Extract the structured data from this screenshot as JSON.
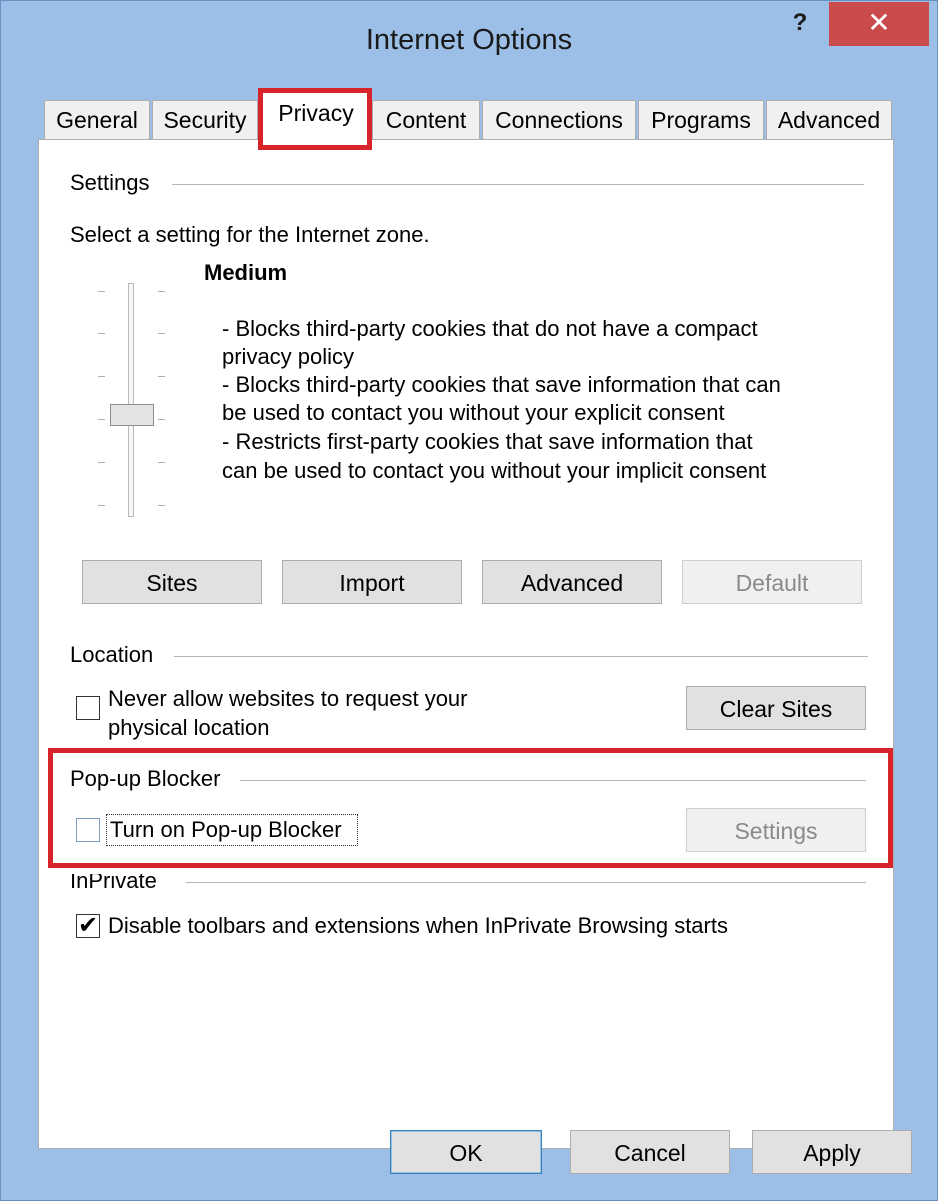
{
  "window": {
    "title": "Internet Options",
    "help_glyph": "?",
    "close_glyph": "✕",
    "accent_close": "#c94b4b",
    "highlight_color": "#d8232a"
  },
  "tabs": [
    {
      "label": "General"
    },
    {
      "label": "Security"
    },
    {
      "label": "Privacy",
      "active": true
    },
    {
      "label": "Content"
    },
    {
      "label": "Connections"
    },
    {
      "label": "Programs"
    },
    {
      "label": "Advanced"
    }
  ],
  "settings": {
    "group_label": "Settings",
    "zone_prompt": "Select a setting for the Internet zone.",
    "level": "Medium",
    "description_lines": [
      "- Blocks third-party cookies that do not have a compact",
      "privacy policy",
      "- Blocks third-party cookies that save information that can",
      "be used to contact you without your explicit consent",
      "- Restricts first-party cookies that save information that",
      "can be used to contact you without your implicit consent"
    ],
    "slider_icon": "vertical-slider",
    "buttons": {
      "sites": "Sites",
      "import": "Import",
      "advanced": "Advanced",
      "default": "Default"
    }
  },
  "location": {
    "group_label": "Location",
    "checkbox_label_line1": "Never allow websites to request your",
    "checkbox_label_line2": "physical location",
    "checked": false,
    "clear_sites": "Clear Sites"
  },
  "popup_blocker": {
    "group_label": "Pop-up Blocker",
    "checkbox_label": "Turn on Pop-up Blocker",
    "checked": false,
    "settings_button": "Settings"
  },
  "inprivate": {
    "group_label": "InPrivate",
    "checkbox_label": "Disable toolbars and extensions when InPrivate Browsing starts",
    "checked": true
  },
  "footer": {
    "ok": "OK",
    "cancel": "Cancel",
    "apply": "Apply"
  }
}
